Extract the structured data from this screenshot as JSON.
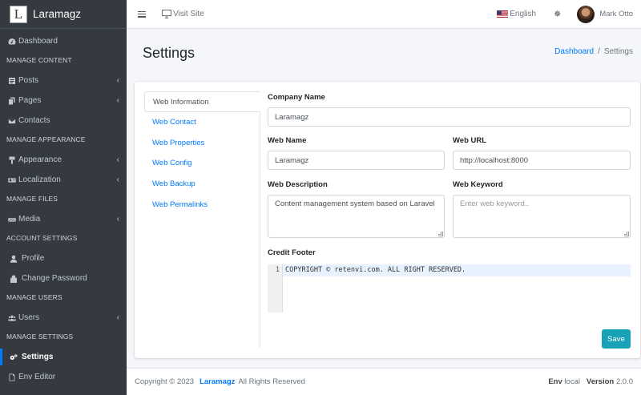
{
  "brand": {
    "logo": "L",
    "name": "Laramagz"
  },
  "sidebar": {
    "dashboard": "Dashboard",
    "h_content": "MANAGE CONTENT",
    "posts": "Posts",
    "pages": "Pages",
    "contacts": "Contacts",
    "h_appearance": "MANAGE APPEARANCE",
    "appearance": "Appearance",
    "localization": "Localization",
    "h_files": "MANAGE FILES",
    "media": "Media",
    "h_account": "ACCOUNT SETTINGS",
    "profile": "Profile",
    "change_password": "Change Password",
    "h_users": "MANAGE USERS",
    "users": "Users",
    "h_settings": "MANAGE SETTINGS",
    "settings": "Settings",
    "env_editor": "Env Editor",
    "chevron": "‹"
  },
  "topbar": {
    "visit_site": "Visit Site",
    "language": "English",
    "user_name": "Mark Otto"
  },
  "page": {
    "title": "Settings",
    "breadcrumb_home": "Dashboard",
    "breadcrumb_sep": "/",
    "breadcrumb_current": "Settings"
  },
  "tabs": [
    "Web Information",
    "Web Contact",
    "Web Properties",
    "Web Config",
    "Web Backup",
    "Web Permalinks"
  ],
  "form": {
    "company_name_label": "Company Name",
    "company_name_value": "Laramagz",
    "web_name_label": "Web Name",
    "web_name_value": "Laramagz",
    "web_url_label": "Web URL",
    "web_url_value": "http://localhost:8000",
    "web_description_label": "Web Description",
    "web_description_value": "Content management system based on Laravel",
    "web_keyword_label": "Web Keyword",
    "web_keyword_placeholder": "Enter web keyword..",
    "credit_footer_label": "Credit Footer",
    "credit_footer_line_no": "1",
    "credit_footer_value": "COPYRIGHT © retenvi.com. ALL RIGHT RESERVED.",
    "save_label": "Save"
  },
  "footer": {
    "copyright": "Copyright © 2023",
    "brand": "Laramagz",
    "rights": "All Rights Reserved",
    "env_label": "Env",
    "env_value": "local",
    "version_label": "Version",
    "version_value": "2.0.0"
  },
  "colors": {
    "sidebar_bg": "#343a40",
    "link": "#007bff",
    "save_button": "#17a2b8",
    "active_indicator": "#007bff"
  },
  "icons": {
    "dashboard": "tachometer-icon",
    "posts": "file-icon",
    "pages": "copy-icon",
    "contacts": "envelope-icon",
    "appearance": "brush-icon",
    "localization": "language-icon",
    "media": "photo-video-icon",
    "profile": "user-icon",
    "change_password": "lock-icon",
    "users": "users-icon",
    "settings": "cogs-icon",
    "env_editor": "file-code-icon"
  }
}
